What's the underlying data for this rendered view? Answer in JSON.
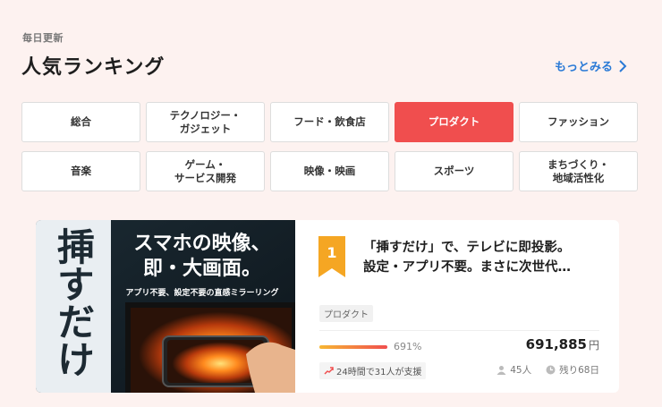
{
  "header": {
    "subtitle": "毎日更新",
    "title": "人気ランキング",
    "see_more": "もっとみる"
  },
  "categories": [
    {
      "label": "総合",
      "active": false
    },
    {
      "label": "テクノロジー・\nガジェット",
      "active": false
    },
    {
      "label": "フード・飲食店",
      "active": false
    },
    {
      "label": "プロダクト",
      "active": true
    },
    {
      "label": "ファッション",
      "active": false
    },
    {
      "label": "音楽",
      "active": false
    },
    {
      "label": "ゲーム・\nサービス開発",
      "active": false
    },
    {
      "label": "映像・映画",
      "active": false
    },
    {
      "label": "スポーツ",
      "active": false
    },
    {
      "label": "まちづくり・\n地域活性化",
      "active": false
    }
  ],
  "ranking": {
    "rank": "1",
    "title": "「挿すだけ」で、テレビに即投影。\n設定・アプリ不要。まさに次世代…",
    "tag": "プロダクト",
    "progress_percent": 691,
    "progress_label": "691%",
    "amount": "691,885",
    "currency": "円",
    "support_text": "24時間で31人が支援",
    "supporters": "45人",
    "remaining": "残り68日",
    "thumbnail": {
      "vertical_text": "挿すだけ",
      "headline_1": "スマホの映像、",
      "headline_2": "即・大画面。",
      "caption": "アプリ不要、設定不要の直感ミラーリング"
    }
  },
  "colors": {
    "background": "#fdf2f0",
    "accent": "#f04e4e",
    "link": "#2a7ad6",
    "rank_badge": "#f5a623"
  }
}
